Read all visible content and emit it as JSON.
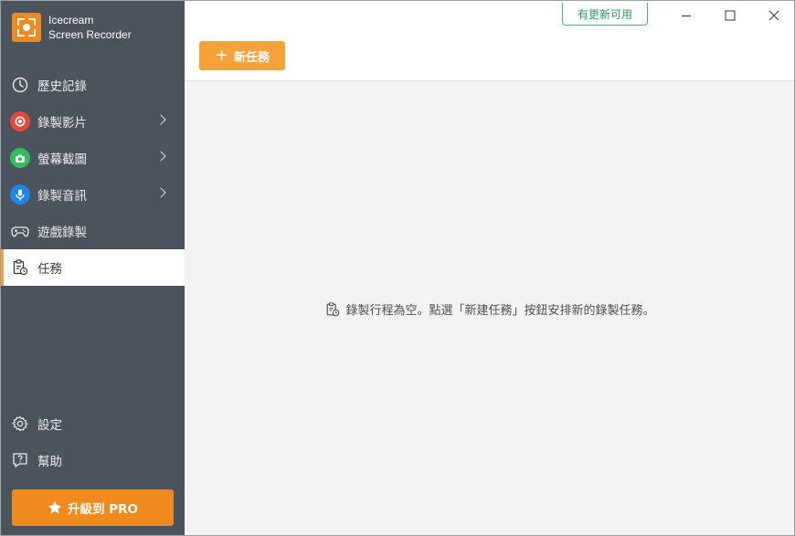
{
  "app": {
    "name_line1": "Icecream",
    "name_line2": "Screen Recorder",
    "brand_color": "#f08a1c"
  },
  "sidebar": {
    "items": [
      {
        "label": "歷史記錄",
        "icon": "clock-icon",
        "has_submenu": false
      },
      {
        "label": "錄製影片",
        "icon": "record-icon",
        "icon_color": "#e8473a",
        "has_submenu": true
      },
      {
        "label": "螢幕截圖",
        "icon": "camera-icon",
        "icon_color": "#2fbf5b",
        "has_submenu": true
      },
      {
        "label": "錄製音訊",
        "icon": "microphone-icon",
        "icon_color": "#1f86e8",
        "has_submenu": true
      },
      {
        "label": "遊戲錄製",
        "icon": "gamepad-icon",
        "has_submenu": false
      },
      {
        "label": "任務",
        "icon": "task-clipboard-icon",
        "has_submenu": false,
        "active": true
      }
    ],
    "bottom_items": [
      {
        "label": "設定",
        "icon": "gear-icon"
      },
      {
        "label": "幫助",
        "icon": "help-icon"
      }
    ],
    "upgrade_label": "升級到 PRO",
    "upgrade_icon": "star-icon"
  },
  "header": {
    "update_badge": "有更新可用",
    "new_task_label": "新任務",
    "new_task_icon": "plus-icon"
  },
  "window_controls": {
    "minimize": "minimize-icon",
    "maximize": "maximize-icon",
    "close": "close-icon"
  },
  "content": {
    "empty_message": "錄製行程為空。點選「新建任務」按鈕安排新的錄製任務。"
  }
}
